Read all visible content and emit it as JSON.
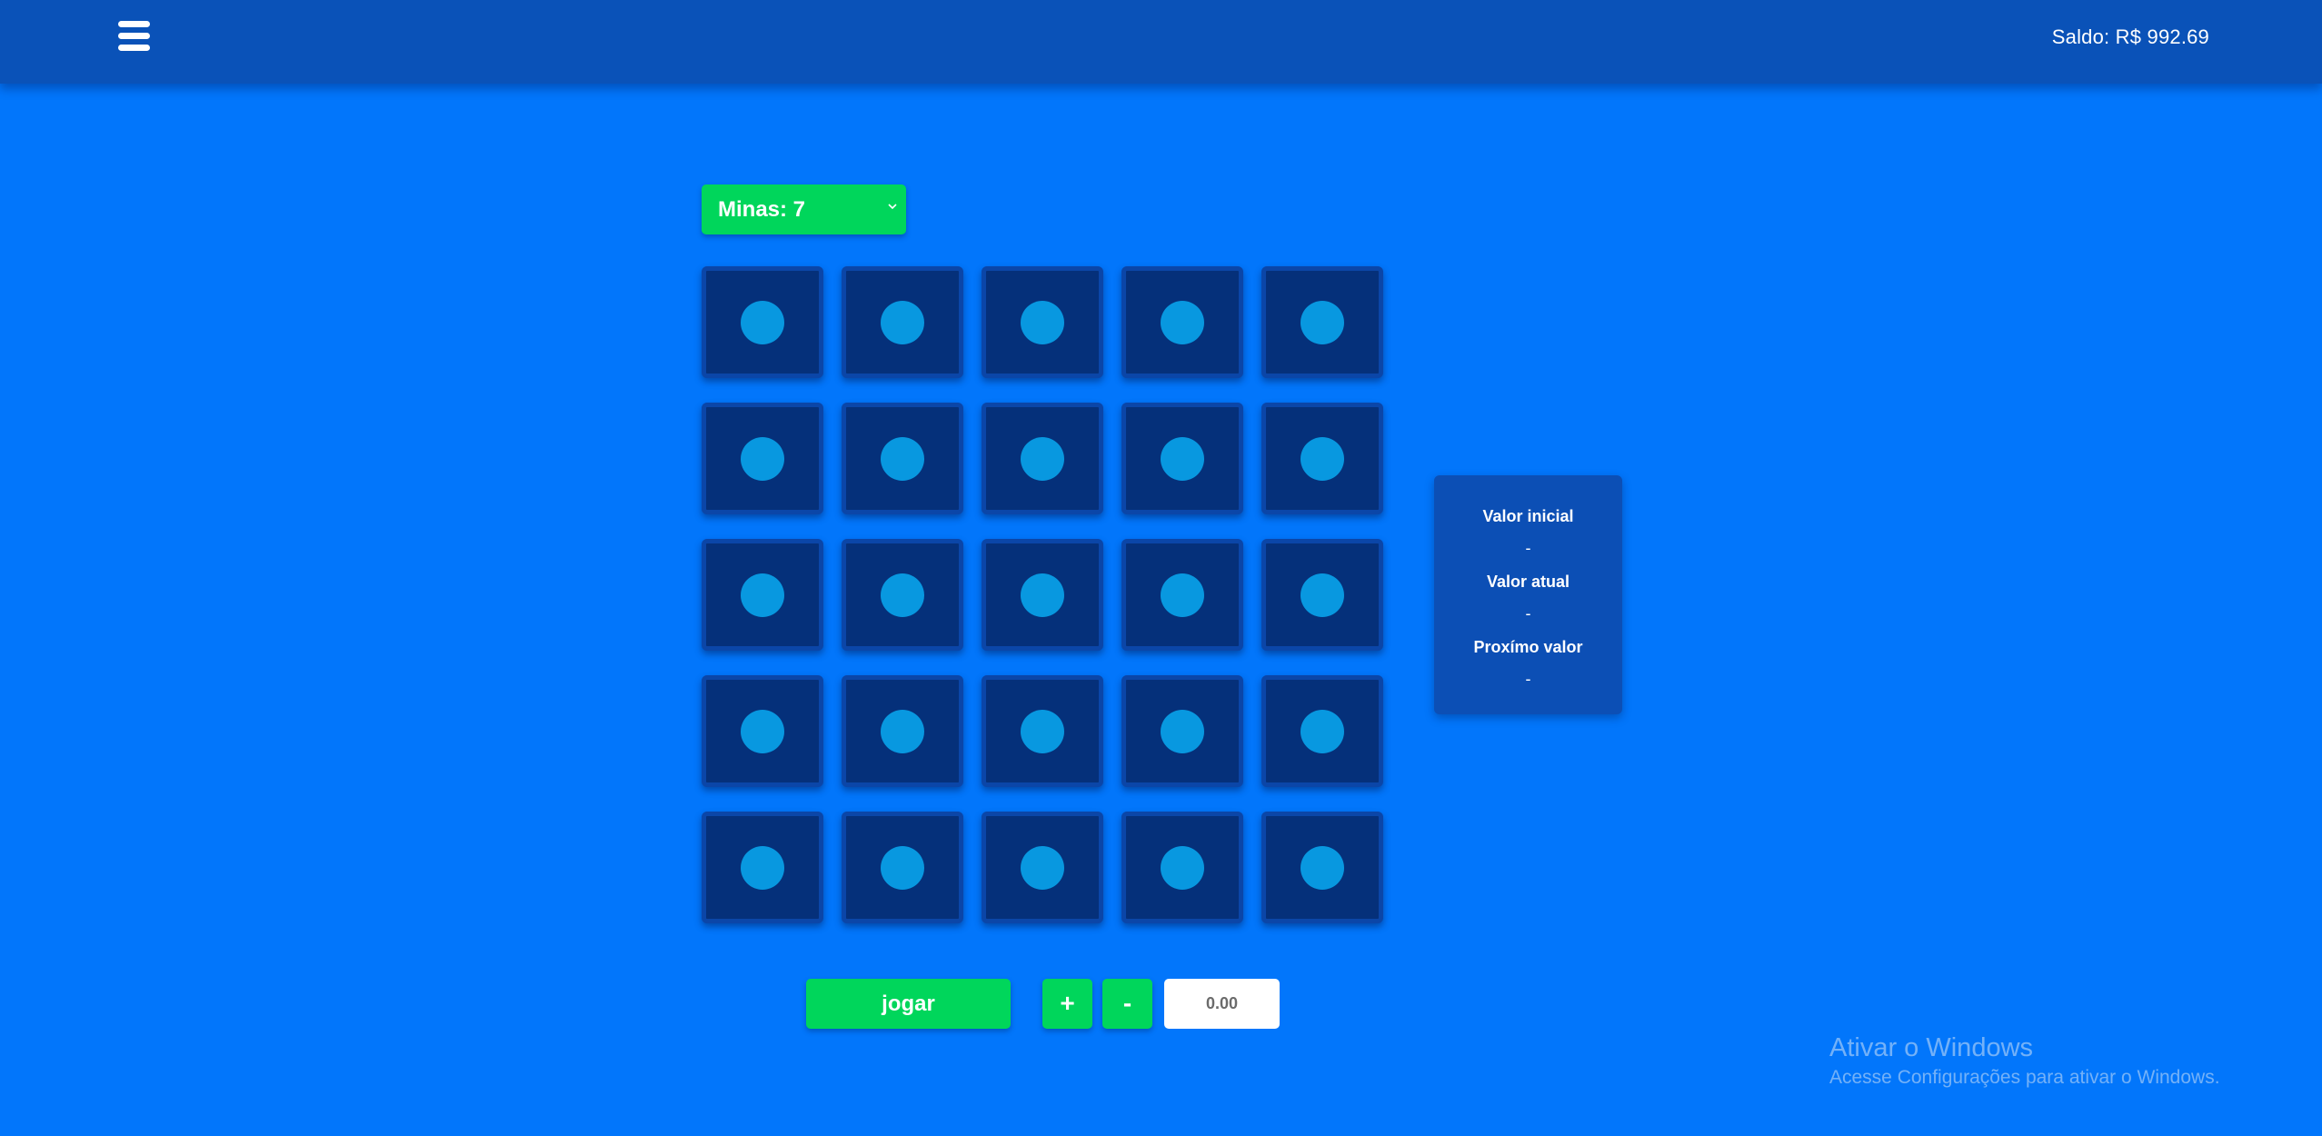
{
  "header": {
    "menu_icon": "hamburger-menu-icon",
    "balance": "Saldo: R$ 992.69"
  },
  "game": {
    "mines_select": "Minas: 7",
    "mines_select_icon": "chevron-down-icon",
    "grid_rows": 5,
    "grid_cols": 5,
    "cell_icon": "circle-icon"
  },
  "info": {
    "initial_label": "Valor inicial",
    "initial_value": "-",
    "current_label": "Valor atual",
    "current_value": "-",
    "next_label": "Proxímo valor",
    "next_value": "-"
  },
  "controls": {
    "play_label": "jogar",
    "plus_label": "+",
    "minus_label": "-",
    "bet_value": "0.00"
  },
  "watermark": {
    "title": "Ativar o Windows",
    "subtitle": "Acesse Configurações para ativar o Windows."
  },
  "colors": {
    "background": "#0276fb",
    "topbar": "#0a52b8",
    "accent_green": "#00d65b",
    "cell": "#05307a",
    "cell_dot": "#0898e0"
  }
}
